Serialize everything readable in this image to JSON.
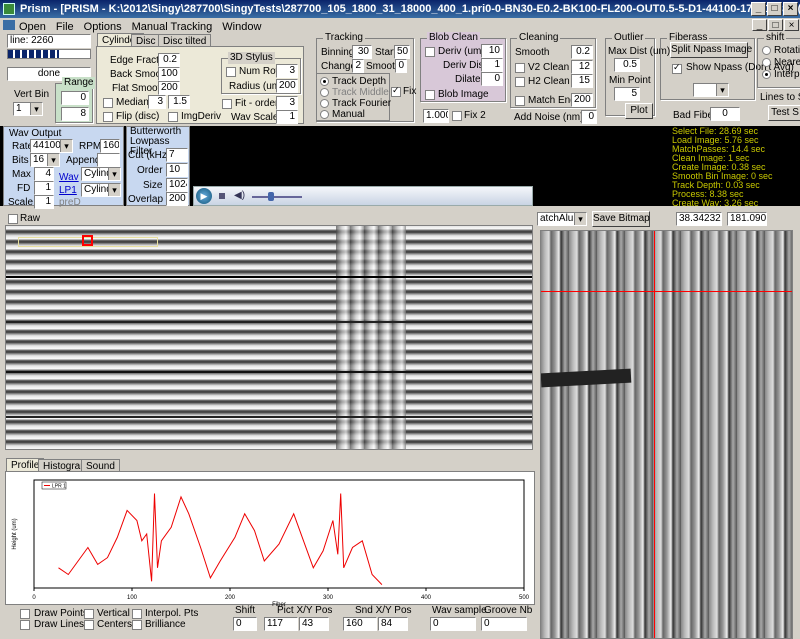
{
  "window": {
    "title": "Prism - [PRISM - K:\\2012\\Singy\\287700\\SingyTests\\287700_105_1800_31_18000_400_1.pri0-0-BN30-E0.2-BK100-FL200-OUT0.5-5-D1-44100-17981.wav (30.28 sec)]",
    "controls": [
      "_",
      "□",
      "×"
    ],
    "mdi_controls": [
      "_",
      "□",
      "×"
    ]
  },
  "menu": [
    "Open",
    "File",
    "Options",
    "Manual Tracking",
    "Window"
  ],
  "line": {
    "label": "line: 2260",
    "status": "done"
  },
  "vert_bin": {
    "label": "Vert Bin",
    "value": "1"
  },
  "range": {
    "label": "Range",
    "v1": "0",
    "v2": "8"
  },
  "tabs_top": [
    "Cylinder",
    "Disc",
    "Disc tilted"
  ],
  "cyl": {
    "edge_lbl": "Edge Fractio",
    "edge": "0.2",
    "back_lbl": "Back Smooth",
    "back": "100",
    "flat_lbl": "Flat Smooth",
    "flat": "200",
    "median_lbl": "Median",
    "median1": "3",
    "median2": "1.5",
    "flip_lbl": "Flip (disc)",
    "imgderiv_lbl": "ImgDeriv"
  },
  "stylus": {
    "title": "3D Stylus",
    "num_row_lbl": "Num Row",
    "num_row": "3",
    "radius_lbl": "Radius (um)",
    "radius": "200",
    "fit_lbl": "Fit - order",
    "fit": "3",
    "wav_scale_lbl": "Wav Scale",
    "wav_scale": "1"
  },
  "tracking": {
    "title": "Tracking",
    "binning_lbl": "Binning",
    "binning": "30",
    "start_lbl": "Start",
    "start": "50",
    "change_lbl": "Change",
    "change": "2",
    "smooth_lbl": "Smooth",
    "smooth": "0",
    "opts": [
      "Track Depth",
      "Track Middle",
      "Track Fourier",
      "Manual"
    ],
    "fix_lbl": "Fix"
  },
  "blob": {
    "title": "Blob Clean",
    "deriv_lbl": "Deriv (um)",
    "deriv": "10",
    "deriv_dist_lbl": "Deriv Dist",
    "deriv_dist": "1",
    "dilate_lbl": "Dilate",
    "dilate": "0",
    "blob_image_lbl": "Blob Image",
    "val": "1.000",
    "fix2_lbl": "Fix 2"
  },
  "cleaning": {
    "title": "Cleaning",
    "smooth_lbl": "Smooth",
    "smooth": "0.2",
    "v2_lbl": "V2 Clean",
    "v2": "12",
    "h2_lbl": "H2 Clean",
    "h2": "15",
    "match_lbl": "Match Ends",
    "match": "200",
    "noise_lbl": "Add Noise  (nm)",
    "noise": "0"
  },
  "outlier": {
    "title": "Outlier",
    "max_lbl": "Max Dist (um)",
    "max": "0.5",
    "min_lbl": "Min Point",
    "min": "5",
    "plot": "Plot"
  },
  "fiberass": {
    "title": "Fiberass",
    "split": "Split Npass Image",
    "show_lbl": "Show Npass (Don't Avg)",
    "bad_lbl": "Bad Fiber",
    "bad": "0"
  },
  "shift": {
    "title": "shift",
    "opts": [
      "Rotati",
      "Neare",
      "Interpo"
    ],
    "lines": "Lines to Sh",
    "test": "Test S"
  },
  "wav": {
    "title": "Wav Output",
    "rate_lbl": "Rate",
    "rate": "44100",
    "rpm_lbl": "RPM",
    "rpm": "160",
    "bits_lbl": "Bits",
    "bits": "16",
    "append_lbl": "Append",
    "max_lbl": "Max",
    "max": "4",
    "fd_lbl": "FD",
    "fd": "1",
    "scale_lbl": "Scale",
    "scale": "1",
    "wav_link": "Wav",
    "lp1_link": "LP1",
    "pred": "preD",
    "cyl1": "Cylinde",
    "cyl2": "Cylinde"
  },
  "butter": {
    "title": "Butterworth Lowpass Filter",
    "cut_lbl": "Cut (kHz)",
    "cut": "7",
    "order_lbl": "Order",
    "order": "10",
    "size_lbl": "Size",
    "size": "1024",
    "overlap_lbl": "Overlap",
    "overlap": "200"
  },
  "stats": [
    "Select File: 28.69 sec",
    "Load Image: 5.76 sec",
    "MatchPasses: 14.4 sec",
    "Clean Image: 1 sec",
    "Create Image: 0.38 sec",
    "Smooth Bin Image: 0 sec",
    "Track Depth: 0.03 sec",
    "Process: 8.38 sec",
    "Create Wav: 3.26 sec"
  ],
  "raw_lbl": "Raw",
  "right_panel": {
    "dd": "atchAlu",
    "save": "Save Bitmap",
    "c1": "38.34232",
    "c2": "181.0909"
  },
  "tabs_bottom": [
    "Profile",
    "Histograms",
    "Sound"
  ],
  "legend": "LPR 1",
  "chart_data": {
    "type": "line",
    "xlabel": "Fiber",
    "ylabel": "Height (um)",
    "x_ticks": [
      "0",
      "100",
      "200",
      "300",
      "400",
      "500"
    ],
    "series": [
      {
        "name": "LPR 1",
        "values": [
          [
            25,
            6
          ],
          [
            35,
            4
          ],
          [
            45,
            8
          ],
          [
            55,
            12
          ],
          [
            65,
            7
          ],
          [
            75,
            9
          ],
          [
            85,
            15
          ],
          [
            95,
            23
          ],
          [
            105,
            20
          ],
          [
            110,
            14
          ],
          [
            115,
            16
          ],
          [
            120,
            2
          ],
          [
            123,
            28
          ],
          [
            126,
            6
          ],
          [
            130,
            14
          ],
          [
            140,
            18
          ],
          [
            150,
            27
          ],
          [
            158,
            22
          ],
          [
            170,
            12
          ],
          [
            180,
            3
          ],
          [
            190,
            8
          ],
          [
            205,
            15
          ],
          [
            215,
            22
          ],
          [
            225,
            17
          ],
          [
            235,
            8
          ],
          [
            250,
            13
          ],
          [
            265,
            22
          ],
          [
            275,
            14
          ],
          [
            285,
            6
          ],
          [
            295,
            11
          ],
          [
            305,
            20
          ],
          [
            310,
            10
          ],
          [
            313,
            28
          ],
          [
            316,
            6
          ],
          [
            325,
            12
          ],
          [
            335,
            14
          ],
          [
            345,
            4
          ],
          [
            355,
            1
          ]
        ]
      }
    ]
  },
  "bottom": {
    "draw_points": "Draw Points",
    "draw_lines": "Draw Lines",
    "vertical": "Vertical",
    "centers": "Centers",
    "interp": "Interpol. Pts",
    "brill": "Brilliance",
    "shift_lbl": "Shift",
    "shift": "0",
    "pict_lbl": "Pict X/Y Pos",
    "pict_x": "117",
    "pict_y": "43",
    "snd_lbl": "Snd X/Y Pos",
    "snd_x": "160",
    "snd_y": "84",
    "wav_lbl": "Wav sample",
    "wav": "0",
    "groove_lbl": "Groove Nb",
    "groove": "0"
  }
}
